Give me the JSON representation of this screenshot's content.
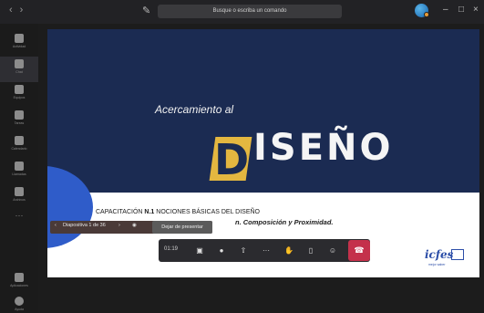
{
  "titlebar": {
    "back_icon": "chevron-left-icon",
    "forward_icon": "chevron-right-icon",
    "compose_icon": "compose-icon",
    "search_text": "Busque o escriba un comando",
    "window_min": "–",
    "window_max": "□",
    "window_close": "×"
  },
  "rail": {
    "items": [
      {
        "label": "Actividad",
        "icon": "bell-icon"
      },
      {
        "label": "Chat",
        "icon": "chat-icon"
      },
      {
        "label": "Equipos",
        "icon": "teams-icon"
      },
      {
        "label": "Tareas",
        "icon": "tasks-icon"
      },
      {
        "label": "Calendario",
        "icon": "calendar-icon"
      },
      {
        "label": "Llamadas",
        "icon": "phone-icon"
      },
      {
        "label": "Archivos",
        "icon": "files-icon"
      }
    ],
    "more": "···",
    "bottom_items": [
      {
        "label": "Aplicaciones",
        "icon": "apps-icon"
      },
      {
        "label": "Ayuda",
        "icon": "help-icon"
      }
    ]
  },
  "slide": {
    "title_small": "Acercamiento al",
    "title_letter": "D",
    "title_big": "ISEÑO",
    "caption_prefix": "CAPACITACIÓN ",
    "caption_bold": "N.1",
    "caption_rest": "   NOCIONES BÁSICAS DEL DISEÑO",
    "subline": "n. Composición y Proximidad.",
    "logo_text": "icfes",
    "logo_sub": "mejor saber"
  },
  "slide_controls": {
    "prev": "‹",
    "counter": "Diapositiva 1 de 36",
    "next": "›",
    "eye_icon": "eye-icon",
    "stop_label": "Dejar de presentar"
  },
  "call": {
    "timer": "01:19",
    "camera_icon": "camera-off-icon",
    "mic_icon": "mic-icon",
    "share_icon": "share-tray-icon",
    "more_icon": "more-icon",
    "hand_icon": "raise-hand-icon",
    "chat_icon": "chat-icon",
    "people_icon": "participants-icon",
    "hangup_icon": "hang-up-icon"
  },
  "colors": {
    "slide_navy": "#1b2b52",
    "accent_yellow": "#e4b740",
    "hangup_red": "#c4314b",
    "brand_blue": "#2c4ea8"
  }
}
